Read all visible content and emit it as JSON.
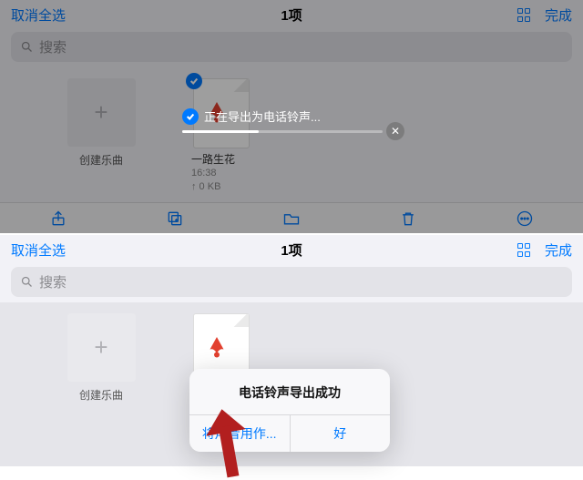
{
  "common": {
    "deselect": "取消全选",
    "count": "1项",
    "done": "完成",
    "search_placeholder": "搜索",
    "create_label": "创建乐曲"
  },
  "song": {
    "title": "一路生花",
    "time": "16:38",
    "size": "↑ 0 KB"
  },
  "export_hud": {
    "text": "正在导出为电话铃声..."
  },
  "alert": {
    "title": "电话铃声导出成功",
    "use_as": "将声音用作...",
    "ok": "好"
  }
}
